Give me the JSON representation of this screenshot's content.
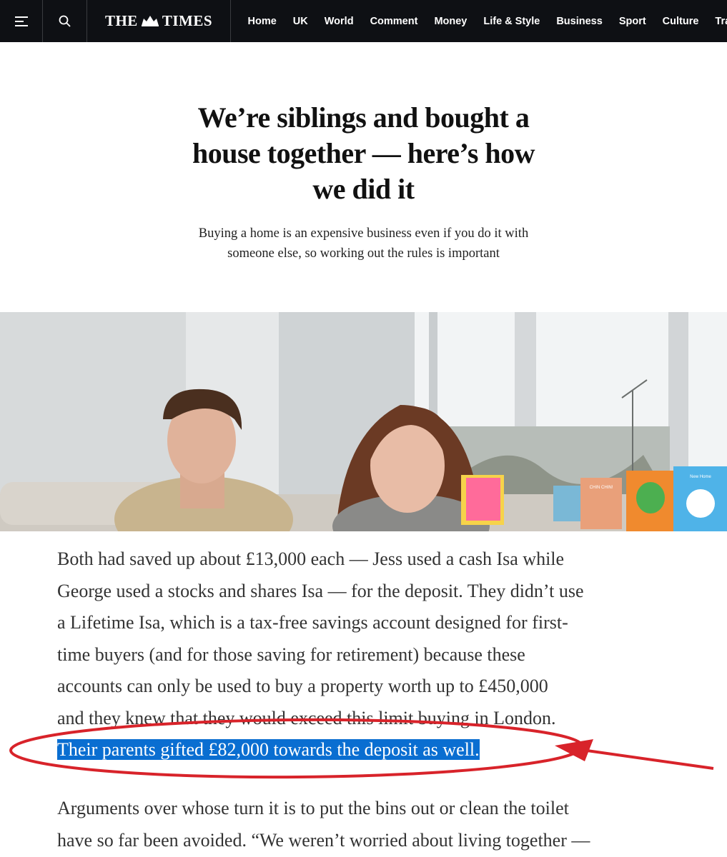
{
  "nav": {
    "logo": "THE TIMES",
    "items": [
      "Home",
      "UK",
      "World",
      "Comment",
      "Money",
      "Life & Style",
      "Business",
      "Sport",
      "Culture",
      "Travel"
    ]
  },
  "article": {
    "headline_lines": [
      "We’re siblings and bought a",
      "house together — here’s how",
      "we did it"
    ],
    "standfirst_lines": [
      "Buying a home is an expensive business even if you do it with",
      "someone else, so working out the rules is important"
    ],
    "paragraph1_lines": [
      "Both had saved up about £13,000 each — Jess used a cash Isa while",
      "George used a stocks and shares Isa — for the deposit. They didn’t use",
      "a Lifetime Isa, which is a tax-free savings account designed for first-",
      "time buyers (and for those saving for retirement) because these",
      "accounts can only be used to buy a property worth up to £450,000",
      "and they knew that they would exceed this limit buying in London."
    ],
    "highlighted_sentence": "Their parents gifted £82,000 towards the deposit as well.",
    "paragraph2_lines": [
      "Arguments over whose turn it is to put the bins out or clean the toilet",
      "have so far been avoided. “We weren’t worried about living together —"
    ],
    "photo_cards": {
      "chin_chin": "CHIN CHIN!",
      "new_home": "New Home"
    }
  },
  "colors": {
    "nav_bg": "#0e1014",
    "highlight": "#0a6ed1",
    "annotation": "#d8232a"
  },
  "icons": [
    "menu-icon",
    "search-icon",
    "crest-icon"
  ]
}
